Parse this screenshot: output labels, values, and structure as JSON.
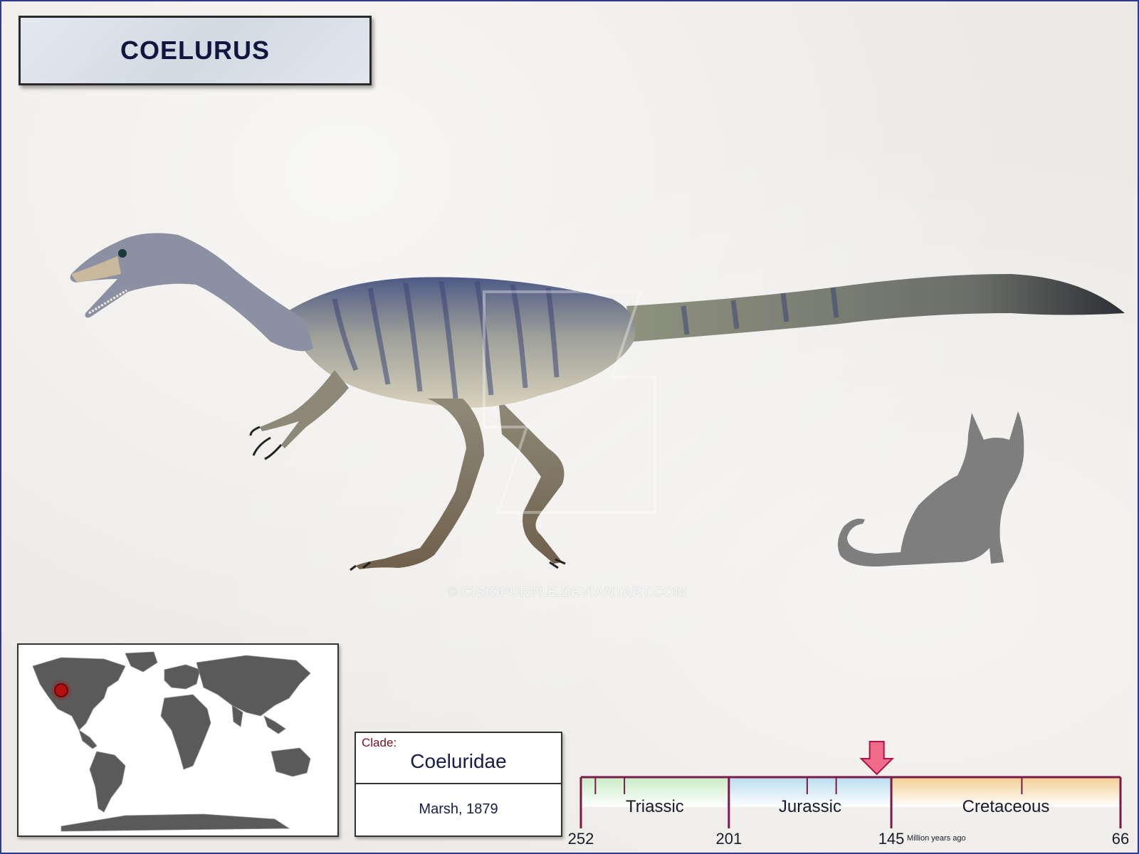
{
  "title": "COELURUS",
  "watermark": "© CISIOPURPLE.DEVIANTART.COM",
  "clade": {
    "label": "Clade:",
    "name": "Coeluridae",
    "author": "Marsh, 1879"
  },
  "timeline": {
    "periods": [
      {
        "name": "Triassic",
        "start": 252,
        "end": 201,
        "color": "#c9ecc4"
      },
      {
        "name": "Jurassic",
        "start": 201,
        "end": 145,
        "color": "#b9dcef"
      },
      {
        "name": "Cretaceous",
        "start": 145,
        "end": 66,
        "color": "#f3cf92"
      }
    ],
    "boundary_labels": [
      "252",
      "201",
      "145",
      "66"
    ],
    "unit": "Million years ago",
    "marker_mya": 150,
    "line_color": "#7a1a4a",
    "marker_color": "#f06a8a"
  },
  "map": {
    "location_marker": "red-dot",
    "location_region": "western North America"
  },
  "icons": {
    "silhouette": "cat-silhouette-icon",
    "animal": "coelurus-illustration"
  }
}
